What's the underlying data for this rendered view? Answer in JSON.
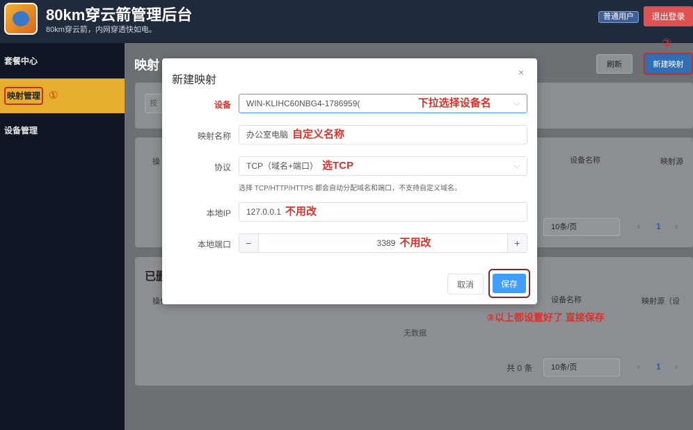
{
  "app": {
    "title": "80km穿云箭管理后台",
    "subtitle": "80km穿云箭，内网穿透快如电。",
    "user_badge": "普通用户",
    "logout": "退出登录"
  },
  "sidebar": {
    "items": [
      {
        "label": "套餐中心"
      },
      {
        "label": "映射管理",
        "annotation": "①"
      },
      {
        "label": "设备管理"
      }
    ]
  },
  "main": {
    "page_title": "映射",
    "refresh": "刷新",
    "new_mapping": "新建映射",
    "new_annotation": "②",
    "filter_chip": "按",
    "table1": {
      "col_op": "操",
      "col_device": "设备名称",
      "col_source": "映射源",
      "page_size": "10条/页",
      "page": "1"
    },
    "section2_title": "已删",
    "table2": {
      "col_op": "操作",
      "col_device": "设备名称",
      "col_source": "映射源（设",
      "empty": "无数据",
      "total": "共 0 条",
      "page_size": "10条/页",
      "page": "1"
    }
  },
  "dialog": {
    "title": "新建映射",
    "close": "×",
    "fields": {
      "device_label": "设备",
      "device_value": "WIN-KLIHC60NBG4-1786959(",
      "device_annot": "下拉选择设备名",
      "name_label": "映射名称",
      "name_value": "办公室电脑",
      "name_annot": "自定义名称",
      "protocol_label": "协议",
      "protocol_value": "TCP（域名+端口）",
      "protocol_annot": "选TCP",
      "protocol_hint": "选择 TCP/HTTP/HTTPS 都会自动分配域名和端口，不支持自定义域名。",
      "ip_label": "本地IP",
      "ip_value": "127.0.0.1",
      "ip_annot": "不用改",
      "port_label": "本地端口",
      "port_value": "3389",
      "port_annot": "不用改"
    },
    "cancel": "取消",
    "save": "保存",
    "save_annotation": "③以上都设置好了 直接保存"
  }
}
